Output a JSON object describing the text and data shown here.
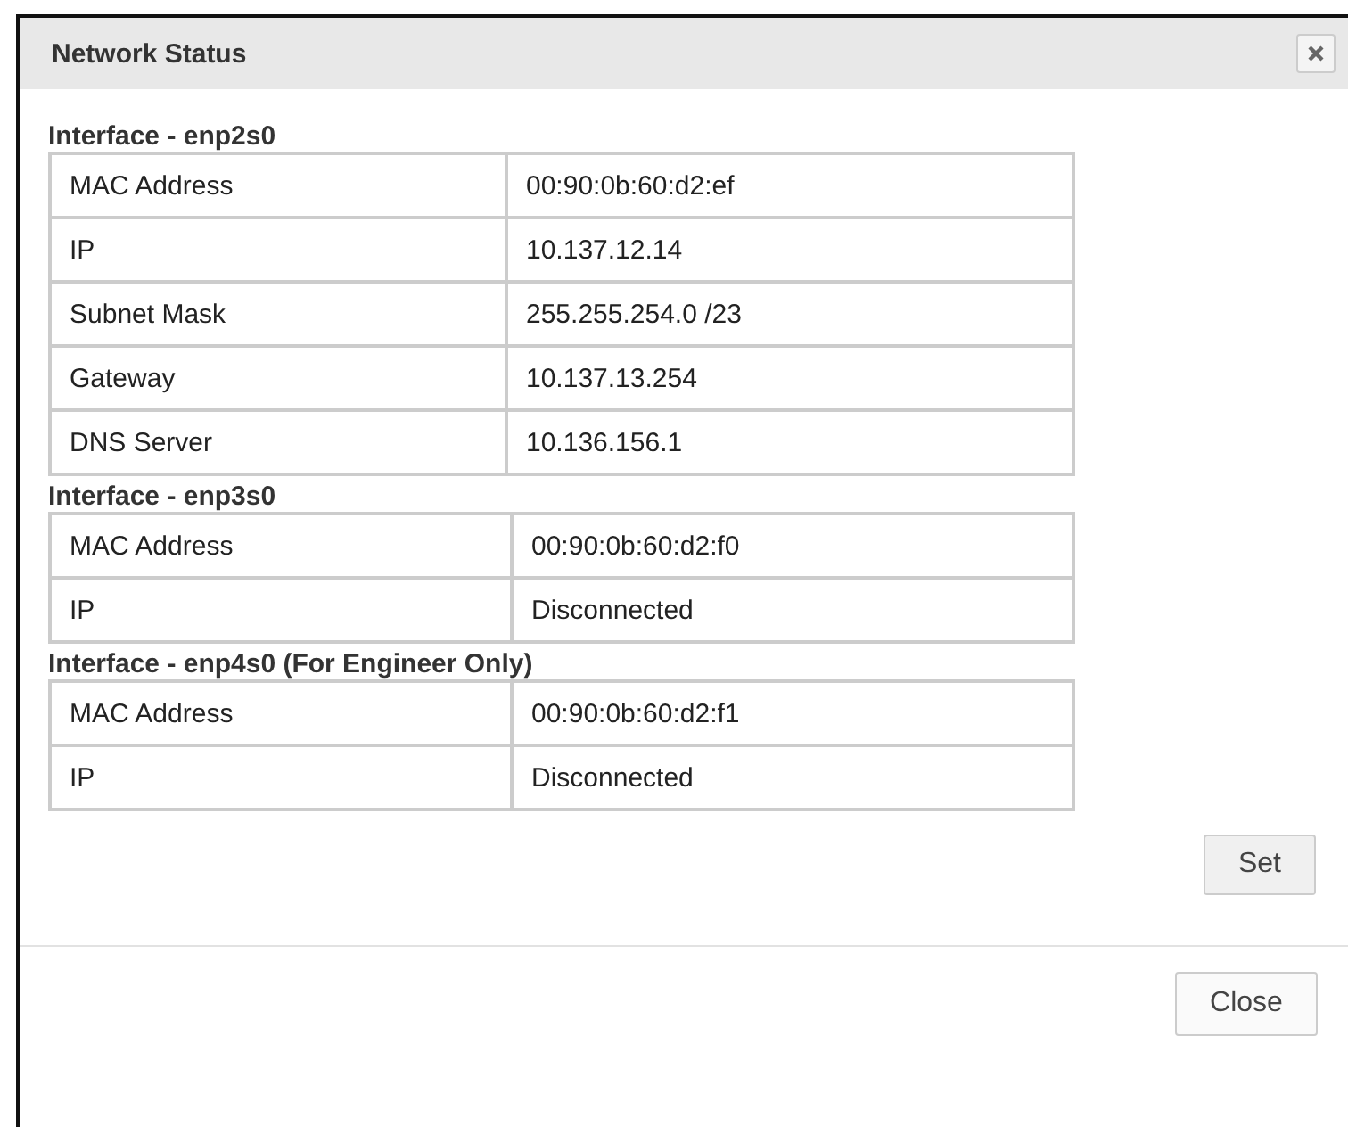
{
  "window": {
    "title": "Network Status"
  },
  "interfaces": [
    {
      "title": "Interface  -  enp2s0",
      "rows": [
        {
          "label": "MAC Address",
          "value": "00:90:0b:60:d2:ef"
        },
        {
          "label": "IP",
          "value": "10.137.12.14"
        },
        {
          "label": "Subnet Mask",
          "value": "255.255.254.0 /23"
        },
        {
          "label": "Gateway",
          "value": "10.137.13.254"
        },
        {
          "label": "DNS Server",
          "value": "10.136.156.1"
        }
      ]
    },
    {
      "title": "Interface  -  enp3s0",
      "rows": [
        {
          "label": "MAC Address",
          "value": "00:90:0b:60:d2:f0"
        },
        {
          "label": "IP",
          "value": "Disconnected"
        }
      ]
    },
    {
      "title": "Interface  -  enp4s0 (For Engineer Only)",
      "rows": [
        {
          "label": "MAC Address",
          "value": "00:90:0b:60:d2:f1"
        },
        {
          "label": "IP",
          "value": "Disconnected"
        }
      ]
    }
  ],
  "set_button": "Set",
  "close_button": "Close"
}
